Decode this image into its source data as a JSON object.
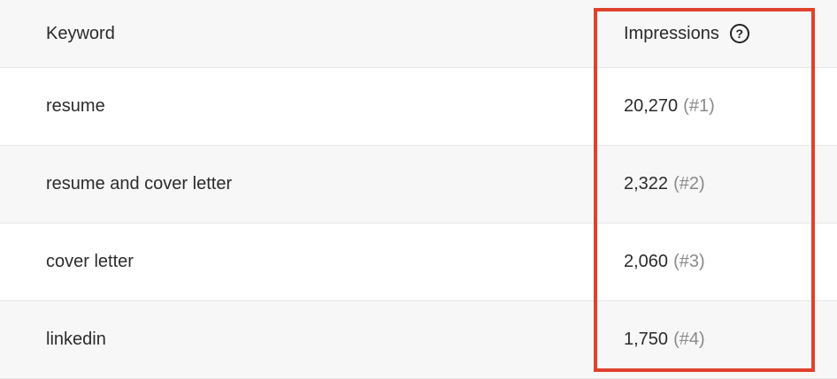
{
  "table": {
    "headers": {
      "keyword": "Keyword",
      "impressions": "Impressions"
    },
    "help_icon": "question-circle-icon",
    "rows": [
      {
        "keyword": "resume",
        "impressions": "20,270",
        "rank": "(#1)"
      },
      {
        "keyword": "resume and cover letter",
        "impressions": "2,322",
        "rank": "(#2)"
      },
      {
        "keyword": "cover letter",
        "impressions": "2,060",
        "rank": "(#3)"
      },
      {
        "keyword": "linkedin",
        "impressions": "1,750",
        "rank": "(#4)"
      }
    ]
  },
  "highlight": {
    "color": "#e0412c"
  }
}
